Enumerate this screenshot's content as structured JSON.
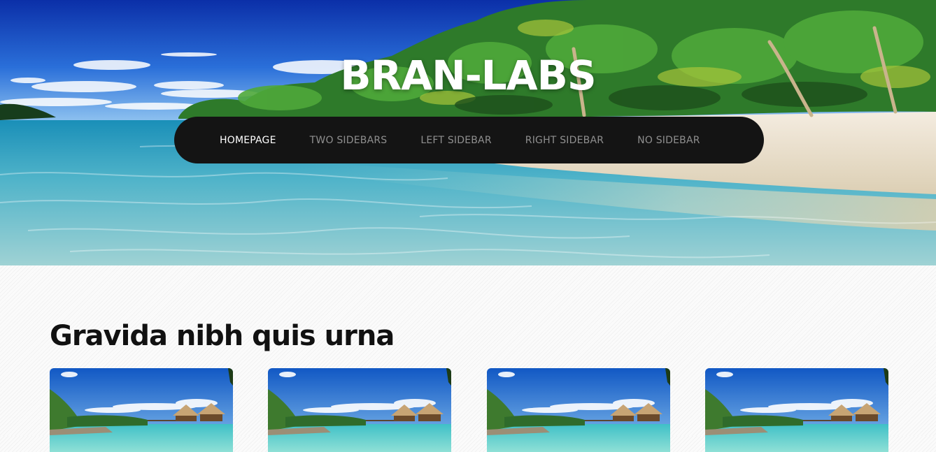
{
  "site": {
    "title": "BRAN-LABS"
  },
  "nav": {
    "items": [
      {
        "label": "HOMEPAGE",
        "active": true
      },
      {
        "label": "TWO SIDEBARS",
        "active": false
      },
      {
        "label": "LEFT SIDEBAR",
        "active": false
      },
      {
        "label": "RIGHT SIDEBAR",
        "active": false
      },
      {
        "label": "NO SIDEBAR",
        "active": false
      }
    ]
  },
  "main": {
    "section_title": "Gravida nibh quis urna",
    "cards": [
      {
        "image": "tropical-bungalow-image"
      },
      {
        "image": "tropical-bungalow-image"
      },
      {
        "image": "tropical-bungalow-image"
      },
      {
        "image": "tropical-bungalow-image"
      }
    ]
  },
  "colors": {
    "nav_background": "#141414",
    "nav_text": "#8f8f8f",
    "nav_active_text": "#ffffff",
    "title_text": "#ffffff",
    "heading_text": "#111111"
  }
}
